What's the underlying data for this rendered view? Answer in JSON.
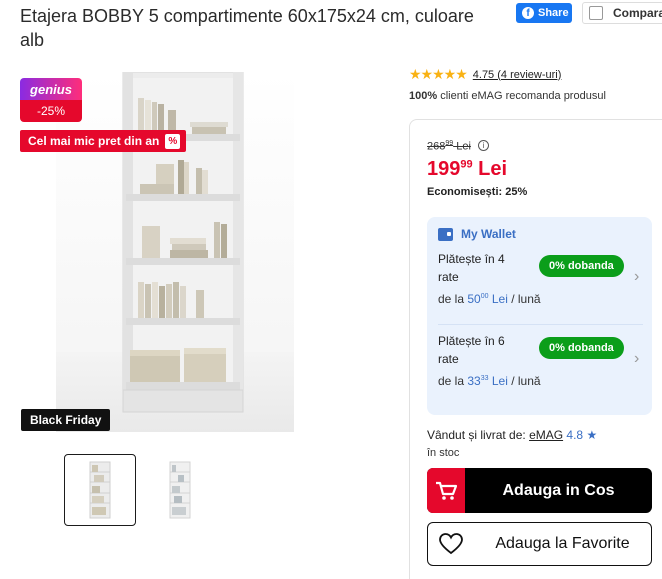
{
  "product": {
    "title": "Etajera BOBBY 5 compartimente 60x175x24 cm, culoare alb"
  },
  "share": {
    "label": "Share"
  },
  "compare": {
    "label": "Compara"
  },
  "badges": {
    "genius": "genius",
    "discount": "-25%",
    "promo": "Cel mai mic pret din an",
    "promo_icon": "%",
    "black_friday": "Black Friday"
  },
  "rating": {
    "stars": "★★★★★",
    "text": "4.75 (4 review-uri)",
    "value": 4.75
  },
  "recommend": {
    "percent": "100%",
    "text": " clienti eMAG recomanda produsul"
  },
  "price": {
    "old_int": "268",
    "old_dec": "99",
    "old_cur": " Lei",
    "new_int": "199",
    "new_dec": "99",
    "new_cur": " Lei",
    "savings": "Economisești: 25%"
  },
  "wallet": {
    "title": "My Wallet",
    "options": [
      {
        "label": "Plătește în 4 rate",
        "pill": "0% dobanda",
        "prefix": "de la ",
        "amount_int": "50",
        "amount_dec": "00",
        "amount_cur": " Lei",
        "suffix": " / lună"
      },
      {
        "label": "Plătește în 6 rate",
        "pill": "0% dobanda",
        "prefix": "de la ",
        "amount_int": "33",
        "amount_dec": "33",
        "amount_cur": " Lei",
        "suffix": " / lună"
      }
    ]
  },
  "seller": {
    "label": "Vândut și livrat de: ",
    "name": "eMAG",
    "score": "4.8",
    "star": "★"
  },
  "stock": "în stoc",
  "actions": {
    "add_to_cart": "Adauga in Cos",
    "add_to_favorites": "Adauga la Favorite"
  },
  "colors": {
    "accent_red": "#e5082c",
    "wallet_blue": "#3a6fc4",
    "green_pill": "#0b9e1a"
  }
}
